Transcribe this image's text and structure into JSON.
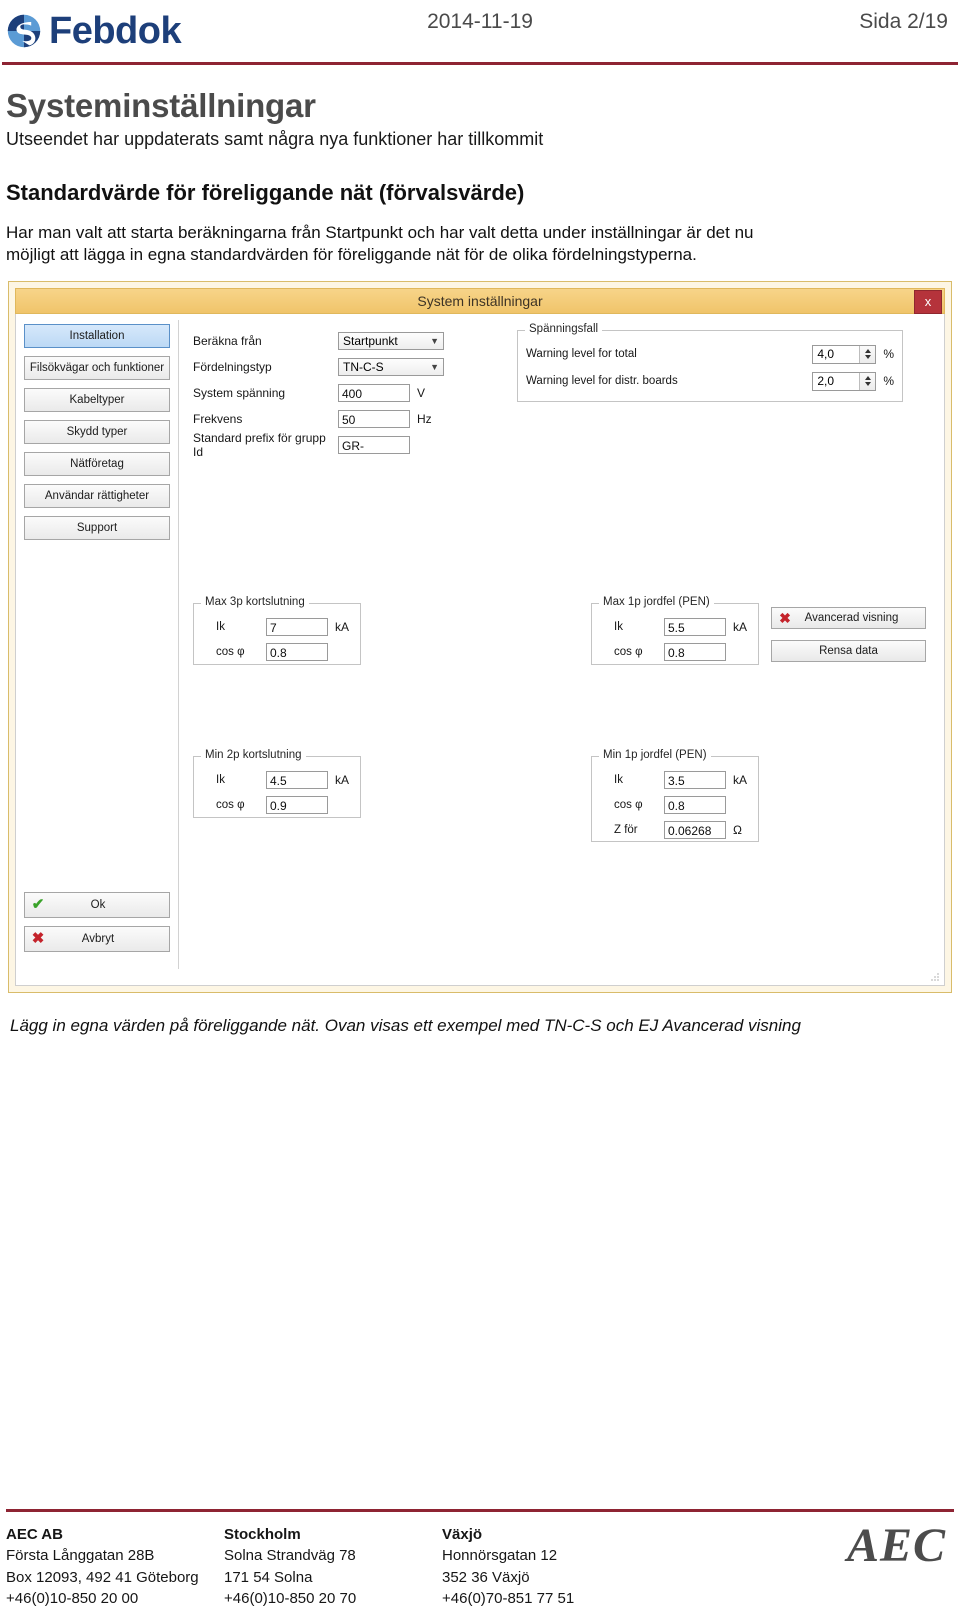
{
  "header": {
    "logo_text": "Febdok",
    "logo_icon": "febdok-swirl-icon",
    "date": "2014-11-19",
    "page_label": "Sida 2/19"
  },
  "document": {
    "title": "Systeminställningar",
    "subtitle": "Utseendet har uppdaterats samt några nya funktioner har tillkommit",
    "section_heading": "Standardvärde för föreliggande nät (förvalsvärde)",
    "paragraph": "Har man valt att starta beräkningarna från Startpunkt och har valt detta under inställningar är det nu möjligt att lägga in egna standardvärden för föreliggande nät för de olika fördelningstyperna.",
    "caption": "Lägg in egna värden på föreliggande nät. Ovan visas ett exempel med TN-C-S och EJ Avancerad visning"
  },
  "dialog": {
    "title": "System inställningar",
    "close_label": "x",
    "sidebar": {
      "items": [
        {
          "label": "Installation",
          "selected": true
        },
        {
          "label": "Filsökvägar och funktioner",
          "selected": false
        },
        {
          "label": "Kabeltyper",
          "selected": false
        },
        {
          "label": "Skydd typer",
          "selected": false
        },
        {
          "label": "Nätföretag",
          "selected": false
        },
        {
          "label": "Användar rättigheter",
          "selected": false
        },
        {
          "label": "Support",
          "selected": false
        }
      ],
      "ok_label": "Ok",
      "ok_icon": "check-icon",
      "cancel_label": "Avbryt",
      "cancel_icon": "red-x-icon"
    },
    "form": {
      "berakna_fran": {
        "label": "Beräkna från",
        "value": "Startpunkt",
        "type": "combo"
      },
      "fordelningstyp": {
        "label": "Fördelningstyp",
        "value": "TN-C-S",
        "type": "combo"
      },
      "system_spanning": {
        "label": "System spänning",
        "value": "400",
        "unit": "V"
      },
      "frekvens": {
        "label": "Frekvens",
        "value": "50",
        "unit": "Hz"
      },
      "prefix": {
        "label": "Standard prefix för grupp Id",
        "value": "GR-",
        "unit": ""
      }
    },
    "voltage_drop": {
      "group_title": "Spänningsfall",
      "rows": [
        {
          "label": "Warning level for total",
          "value": "4,0",
          "unit": "%"
        },
        {
          "label": "Warning level for distr. boards",
          "value": "2,0",
          "unit": "%"
        }
      ]
    },
    "groups": [
      {
        "title": "Max 3p kortslutning",
        "rows": [
          {
            "label": "Ik",
            "value": "7",
            "unit": "kA"
          },
          {
            "label": "cos φ",
            "value": "0.8",
            "unit": ""
          }
        ]
      },
      {
        "title": "Max 1p jordfel (PEN)",
        "rows": [
          {
            "label": "Ik",
            "value": "5.5",
            "unit": "kA"
          },
          {
            "label": "cos φ",
            "value": "0.8",
            "unit": ""
          }
        ]
      },
      {
        "title": "Min 2p kortslutning",
        "rows": [
          {
            "label": "Ik",
            "value": "4.5",
            "unit": "kA"
          },
          {
            "label": "cos φ",
            "value": "0.9",
            "unit": ""
          }
        ]
      },
      {
        "title": "Min 1p jordfel (PEN)",
        "rows": [
          {
            "label": "Ik",
            "value": "3.5",
            "unit": "kA"
          },
          {
            "label": "cos φ",
            "value": "0.8",
            "unit": ""
          },
          {
            "label": "Z för",
            "value": "0.06268",
            "unit": "Ω"
          }
        ]
      }
    ],
    "actions": [
      {
        "label": "Avancerad visning",
        "icon": "red-x-icon"
      },
      {
        "label": "Rensa data",
        "icon": "none"
      }
    ]
  },
  "footer": {
    "columns": [
      {
        "heading": "AEC AB",
        "lines": [
          "Första Långgatan 28B",
          "Box 12093, 492 41 Göteborg",
          "+46(0)10-850 20 00"
        ]
      },
      {
        "heading": "Stockholm",
        "lines": [
          "Solna Strandväg 78",
          "171 54 Solna",
          "+46(0)10-850 20 70"
        ]
      },
      {
        "heading": "Växjö",
        "lines": [
          "Honnörsgatan 12",
          "352 36 Växjö",
          "+46(0)70-851 77 51"
        ]
      }
    ],
    "logo_text": "AEC"
  },
  "colors": {
    "brand_blue": "#1d3f7a",
    "rule_red": "#8e2433",
    "dialog_gold": "#f0c46a",
    "close_red": "#b5333b",
    "select_blue": "#bcd9f5"
  }
}
